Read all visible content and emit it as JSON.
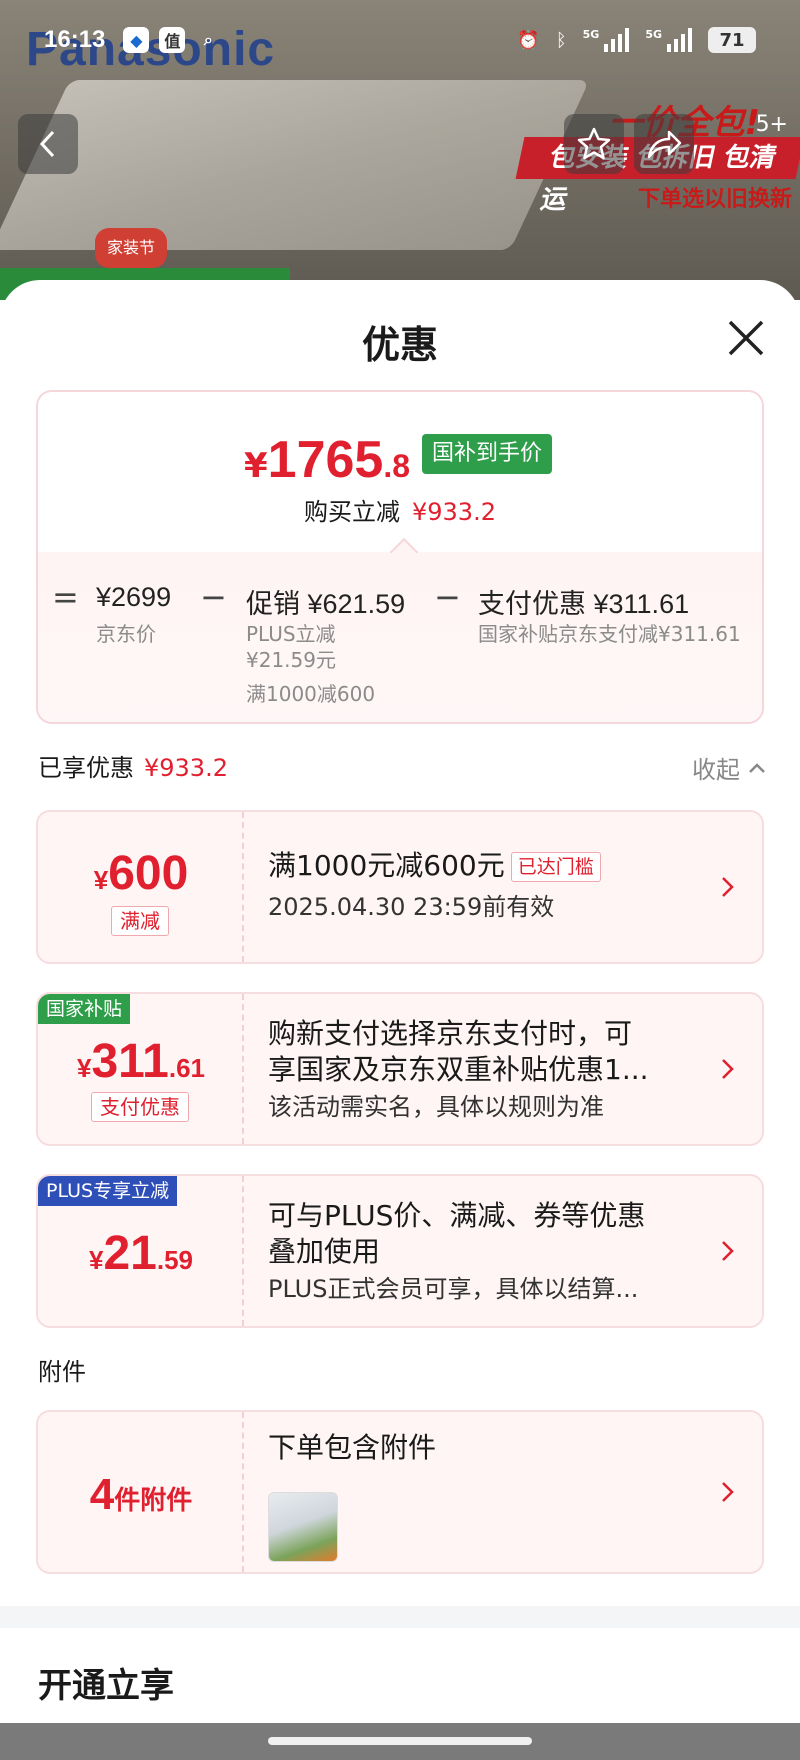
{
  "status_bar": {
    "time": "16:13",
    "net1": "5G",
    "net2": "5G",
    "battery": "71"
  },
  "background": {
    "brand": "Panasonic",
    "promo_title": "一价全包!",
    "promo_strip": "包安装 包拆旧 包清运",
    "promo_sub": "下单选以旧换新",
    "festival": "家装节",
    "badge": "5+"
  },
  "sheet": {
    "title": "优惠"
  },
  "price_summary": {
    "final_yen": "¥",
    "final_int": "1765",
    "final_dec": ".8",
    "tag": "国补到手价",
    "buy_save_label": "购买立减",
    "buy_save_value": "¥933.2",
    "eq": "=",
    "minus": "−",
    "jd_price": "¥2699",
    "jd_price_label": "京东价",
    "promo_label": "促销 ¥621.59",
    "promo_sub1": "PLUS立减",
    "promo_sub2": "¥21.59元",
    "promo_sub3": "满1000减600",
    "pay_label": "支付优惠 ¥311.61",
    "pay_sub": "国家补贴京东支付减¥311.61"
  },
  "enjoyed": {
    "label": "已享优惠",
    "value": "¥933.2",
    "collapse": "收起"
  },
  "promos": [
    {
      "amount_yen": "¥",
      "amount_int": "600",
      "amount_dec": "",
      "chip": "满减",
      "title": "满1000元减600元",
      "badge": "已达门槛",
      "desc": "2025.04.30 23:59前有效"
    },
    {
      "tag": "国家补贴",
      "amount_yen": "¥",
      "amount_int": "311",
      "amount_dec": ".61",
      "chip": "支付优惠",
      "title_l1": "购新支付选择京东支付时，可",
      "title_l2": "享国家及京东双重补贴优惠1...",
      "desc": "该活动需实名，具体以规则为准"
    },
    {
      "tag": "PLUS专享立减",
      "amount_yen": "¥",
      "amount_int": "21",
      "amount_dec": ".59",
      "title_l1": "可与PLUS价、满减、券等优惠",
      "title_l2": "叠加使用",
      "desc": "PLUS正式会员可享，具体以结算..."
    }
  ],
  "attachments": {
    "section_label": "附件",
    "count": "4",
    "count_suffix": "件附件",
    "title": "下单包含附件"
  },
  "footer": {
    "open_now": "开通立享"
  },
  "colors": {
    "accent_red": "#e0202e",
    "gov_green": "#2f9e4a",
    "plus_blue": "#2f4fb8"
  }
}
